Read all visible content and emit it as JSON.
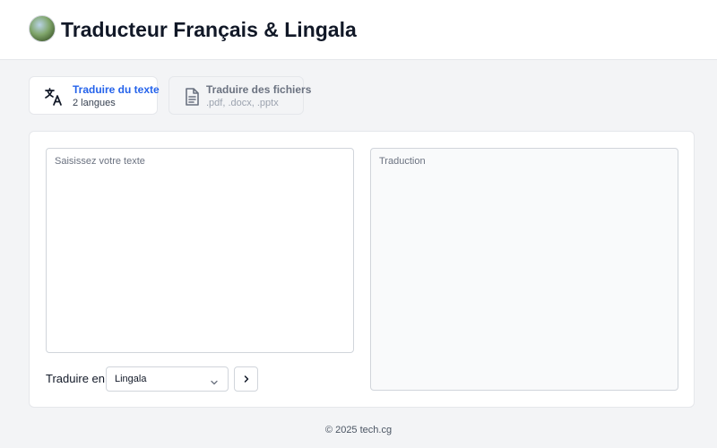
{
  "app": {
    "title": "Traducteur Français & Lingala"
  },
  "tabs": [
    {
      "label": "Traduire du texte",
      "sub": "2 langues",
      "icon": "translate-icon",
      "active": true
    },
    {
      "label": "Traduire des fichiers",
      "sub": ".pdf, .docx, .pptx",
      "icon": "document-icon",
      "active": false
    }
  ],
  "editor": {
    "source_placeholder": "Saisissez votre texte",
    "source_value": "",
    "target_placeholder": "Traduction",
    "translate_to_label": "Traduire en",
    "selected_language": "Lingala",
    "go_icon": "chevron-right-icon"
  },
  "footer": {
    "text": "© 2025 tech.cg"
  },
  "colors": {
    "accent": "#2563eb",
    "background": "#f3f4f6",
    "card": "#ffffff",
    "border": "#e5e7eb"
  }
}
